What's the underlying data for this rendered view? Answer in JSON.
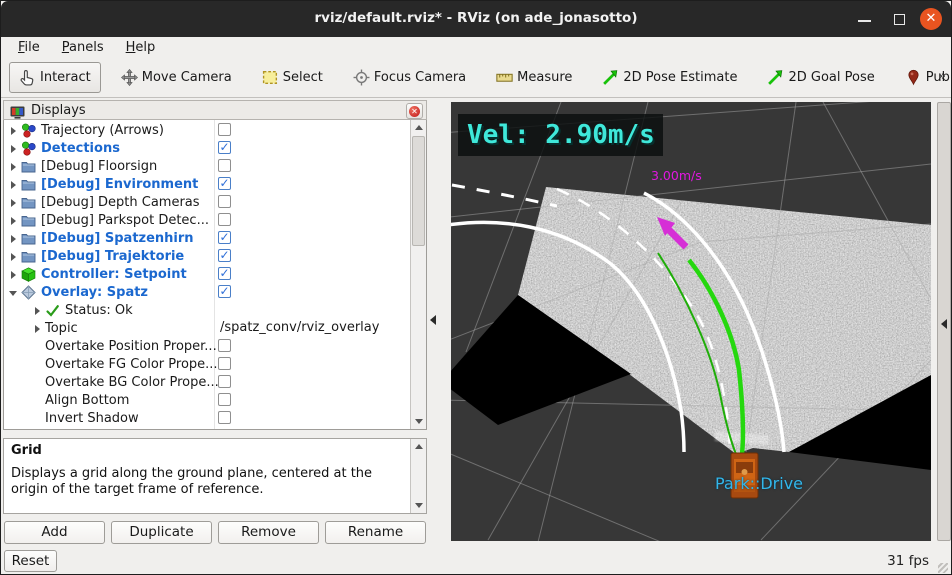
{
  "window": {
    "title": "rviz/default.rviz* - RViz (on ade_jonasotto)"
  },
  "menu": {
    "items": [
      "File",
      "Panels",
      "Help"
    ]
  },
  "toolbar": {
    "tools": [
      {
        "label": "Interact",
        "icon": "hand-icon",
        "active": true
      },
      {
        "label": "Move Camera",
        "icon": "move-icon",
        "active": false
      },
      {
        "label": "Select",
        "icon": "select-icon",
        "active": false
      },
      {
        "label": "Focus Camera",
        "icon": "focus-icon",
        "active": false
      },
      {
        "label": "Measure",
        "icon": "measure-icon",
        "active": false
      },
      {
        "label": "2D Pose Estimate",
        "icon": "pose-arrow-icon",
        "active": false
      },
      {
        "label": "2D Goal Pose",
        "icon": "pose-arrow-icon",
        "active": false
      },
      {
        "label": "Publish Point",
        "icon": "pin-icon",
        "active": false
      },
      {
        "label": "",
        "icon": "plus-icon",
        "active": false
      }
    ],
    "overflow": "»"
  },
  "displays_panel": {
    "title": "Displays",
    "rows": [
      {
        "label": "Trajectory (Arrows)",
        "icon": "axes-icon",
        "bold": false,
        "arrow": "collapsed",
        "indent": 0,
        "checkbox": true,
        "checked": false
      },
      {
        "label": "Detections",
        "icon": "axes-icon",
        "bold": true,
        "arrow": "collapsed",
        "indent": 0,
        "checkbox": true,
        "checked": true
      },
      {
        "label": "[Debug] Floorsign",
        "icon": "folder-icon",
        "bold": false,
        "arrow": "collapsed",
        "indent": 0,
        "checkbox": true,
        "checked": false
      },
      {
        "label": "[Debug] Environment",
        "icon": "folder-icon",
        "bold": true,
        "arrow": "collapsed",
        "indent": 0,
        "checkbox": true,
        "checked": true
      },
      {
        "label": "[Debug] Depth Cameras",
        "icon": "folder-icon",
        "bold": false,
        "arrow": "collapsed",
        "indent": 0,
        "checkbox": true,
        "checked": false
      },
      {
        "label": "[Debug] Parkspot Detec...",
        "icon": "folder-icon",
        "bold": false,
        "arrow": "collapsed",
        "indent": 0,
        "checkbox": true,
        "checked": false
      },
      {
        "label": "[Debug] Spatzenhirn",
        "icon": "folder-icon",
        "bold": true,
        "arrow": "collapsed",
        "indent": 0,
        "checkbox": true,
        "checked": true
      },
      {
        "label": "[Debug] Trajektorie",
        "icon": "folder-icon",
        "bold": true,
        "arrow": "collapsed",
        "indent": 0,
        "checkbox": true,
        "checked": true
      },
      {
        "label": "Controller: Setpoint",
        "icon": "cube-icon",
        "bold": true,
        "arrow": "collapsed",
        "indent": 0,
        "checkbox": true,
        "checked": true
      },
      {
        "label": "Overlay: Spatz",
        "icon": "diamond-icon",
        "bold": true,
        "arrow": "expanded",
        "indent": 0,
        "checkbox": true,
        "checked": true
      },
      {
        "label": "Status: Ok",
        "icon": "check-icon",
        "bold": false,
        "arrow": "collapsed",
        "indent": 1,
        "checkbox": false,
        "checked": false
      },
      {
        "label": "Topic",
        "icon": "none",
        "bold": false,
        "arrow": "collapsed",
        "indent": 1,
        "checkbox": false,
        "checked": false,
        "value": "/spatz_conv/rviz_overlay"
      },
      {
        "label": "Overtake Position Proper...",
        "icon": "none",
        "bold": false,
        "arrow": "none",
        "indent": 1,
        "checkbox": true,
        "checked": false
      },
      {
        "label": "Overtake FG Color Prope...",
        "icon": "none",
        "bold": false,
        "arrow": "none",
        "indent": 1,
        "checkbox": true,
        "checked": false
      },
      {
        "label": "Overtake BG Color Prope...",
        "icon": "none",
        "bold": false,
        "arrow": "none",
        "indent": 1,
        "checkbox": true,
        "checked": false
      },
      {
        "label": "Align Bottom",
        "icon": "none",
        "bold": false,
        "arrow": "none",
        "indent": 1,
        "checkbox": true,
        "checked": false
      },
      {
        "label": "Invert Shadow",
        "icon": "none",
        "bold": false,
        "arrow": "none",
        "indent": 1,
        "checkbox": true,
        "checked": false
      }
    ],
    "help_title": "Grid",
    "help_text": "Displays a grid along the ground plane, centered at the origin of the target frame of reference.",
    "buttons": [
      "Add",
      "Duplicate",
      "Remove",
      "Rename"
    ]
  },
  "viewport": {
    "vel_overlay": "Vel: 2.90m/s",
    "speed_label": "3.00m/s",
    "frame_label": "Park::Drive"
  },
  "statusbar": {
    "reset_label": "Reset",
    "fps": "31 fps"
  },
  "colors": {
    "accent_blue": "#1b68cf",
    "vel_cyan": "#3fe8da",
    "speed_magenta": "#e018e0",
    "frame_cyan": "#32b6ea",
    "trajectory_green": "#25d80e",
    "close_orange": "#e95420"
  }
}
